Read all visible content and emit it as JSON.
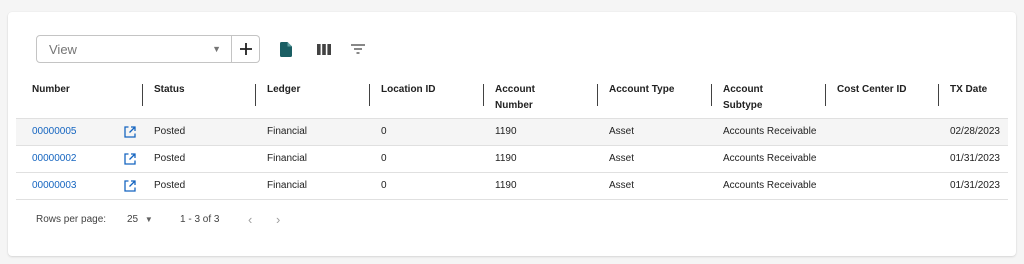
{
  "toolbar": {
    "view_placeholder": "View",
    "icons": [
      "chevron-down-icon",
      "add-icon",
      "file-icon",
      "columns-icon",
      "filter-icon"
    ]
  },
  "table": {
    "columns": [
      "Number",
      "Status",
      "Ledger",
      "Location ID",
      "Account Number",
      "Account Type",
      "Account Subtype",
      "Cost Center ID",
      "TX Date"
    ],
    "rows": [
      {
        "number": "00000005",
        "status": "Posted",
        "ledger": "Financial",
        "location_id": "0",
        "account_number": "1190",
        "account_type": "Asset",
        "account_subtype": "Accounts Receivable",
        "cost_center_id": "",
        "tx_date": "02/28/2023"
      },
      {
        "number": "00000002",
        "status": "Posted",
        "ledger": "Financial",
        "location_id": "0",
        "account_number": "1190",
        "account_type": "Asset",
        "account_subtype": "Accounts Receivable",
        "cost_center_id": "",
        "tx_date": "01/31/2023"
      },
      {
        "number": "00000003",
        "status": "Posted",
        "ledger": "Financial",
        "location_id": "0",
        "account_number": "1190",
        "account_type": "Asset",
        "account_subtype": "Accounts Receivable",
        "cost_center_id": "",
        "tx_date": "01/31/2023"
      }
    ]
  },
  "pagination": {
    "rows_per_page_label": "Rows per page:",
    "rows_per_page_value": "25",
    "range": "1 - 3 of 3"
  },
  "colors": {
    "link": "#1565c0",
    "file_icon": "#1a5e63",
    "selected_row": "#f5f5f5"
  }
}
